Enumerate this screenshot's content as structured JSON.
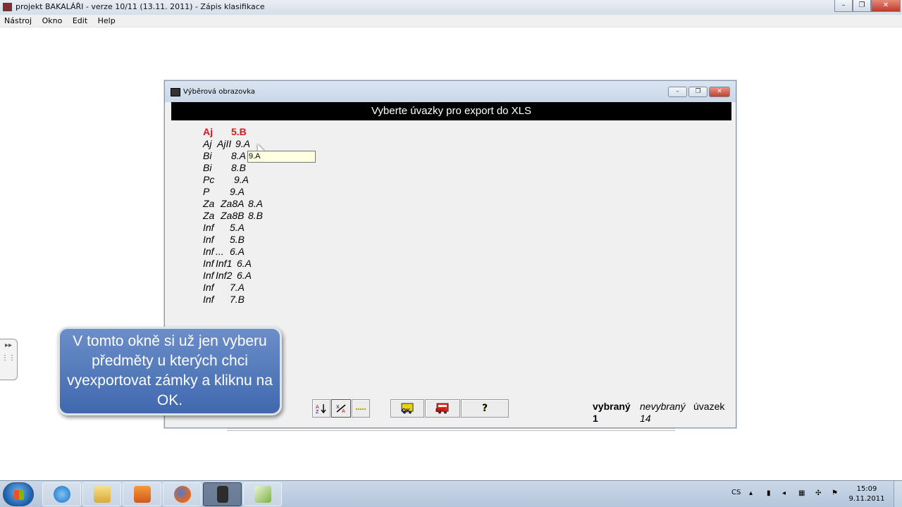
{
  "app": {
    "title": "projekt BAKALÁŘI  - verze 10/11 (13.11. 2011)  - Zápis klasifikace",
    "min_icon": "minimize-icon",
    "max_icon": "restore-icon",
    "close_icon": "close-icon"
  },
  "menubar": {
    "items": [
      "Nástroj",
      "Okno",
      "Edit",
      "Help"
    ]
  },
  "dialog": {
    "title": "Výběrová obrazovka",
    "header": "Vyberte úvazky pro export do XLS",
    "rows": [
      {
        "subject": "Aj",
        "group": "",
        "class": "5.B",
        "selected": true
      },
      {
        "subject": "Aj",
        "group": "AjII",
        "class": "9.A",
        "selected": false
      },
      {
        "subject": "Bi",
        "group": "",
        "class": "8.A",
        "selected": false
      },
      {
        "subject": "Bi",
        "group": "",
        "class": "8.B",
        "selected": false
      },
      {
        "subject": "Pc",
        "group": "",
        "class": "9.A",
        "selected": false
      },
      {
        "subject": "P",
        "group": "",
        "class": "9.A",
        "selected": false
      },
      {
        "subject": "Za",
        "group": "Za8A",
        "class": "8.A",
        "selected": false
      },
      {
        "subject": "Za",
        "group": "Za8B",
        "class": "8.B",
        "selected": false
      },
      {
        "subject": "Inf",
        "group": "",
        "class": "5.A",
        "selected": false
      },
      {
        "subject": "Inf",
        "group": "",
        "class": "5.B",
        "selected": false
      },
      {
        "subject": "Inf",
        "group": "...",
        "class": "6.A",
        "selected": false
      },
      {
        "subject": "Inf",
        "group": "Inf1",
        "class": "6.A",
        "selected": false
      },
      {
        "subject": "Inf",
        "group": "Inf2",
        "class": "6.A",
        "selected": false
      },
      {
        "subject": "Inf",
        "group": "",
        "class": "7.A",
        "selected": false
      },
      {
        "subject": "Inf",
        "group": "",
        "class": "7.B",
        "selected": false
      }
    ],
    "tooltip": "9.A",
    "toolbar": {
      "sort_icon": "sort-az-icon",
      "filter_icon": "filter-percent-icon",
      "line_icon": "dashed-line-icon",
      "ok_label": "OK",
      "esc_label": "ESC",
      "help_label": "?"
    },
    "status": {
      "selected_label": "vybraný",
      "selected_count": "1",
      "unselected_label": "nevybraný",
      "unselected_count": "14",
      "total_label": "úvazek"
    }
  },
  "callout": {
    "text": "V tomto okně si už jen vyberu předměty u kterých chci vyexportovat zámky a kliknu na OK."
  },
  "taskbar": {
    "start_icon": "windows-start-icon",
    "items": [
      "explorer-icon",
      "internet-explorer-icon",
      "file-manager-icon",
      "media-player-icon",
      "firefox-icon",
      "app-icon",
      "spreadsheet-icon"
    ],
    "language": "CS",
    "time": "15:09",
    "date": "9.11.2011"
  },
  "colors": {
    "selected_row": "#e0141d",
    "callout_bg": "#4f77b8"
  }
}
